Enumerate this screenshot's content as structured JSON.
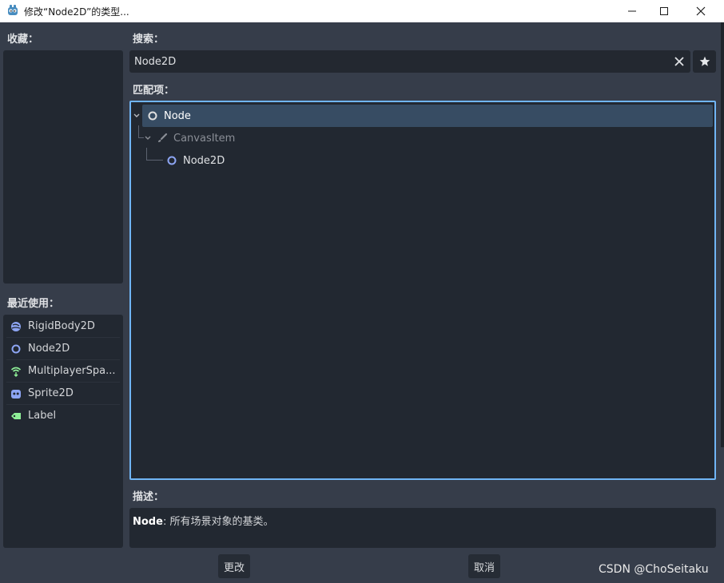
{
  "window": {
    "title": "修改“Node2D”的类型..."
  },
  "favorites": {
    "label": "收藏："
  },
  "recent": {
    "label": "最近使用：",
    "items": [
      {
        "label": "RigidBody2D",
        "icon": "rigidbody2d-icon",
        "color": "#8da5f3"
      },
      {
        "label": "Node2D",
        "icon": "node2d-icon",
        "color": "#8da5f3"
      },
      {
        "label": "MultiplayerSpa...",
        "icon": "multiplayer-spawner-icon",
        "color": "#8eef97"
      },
      {
        "label": "Sprite2D",
        "icon": "sprite2d-icon",
        "color": "#8da5f3"
      },
      {
        "label": "Label",
        "icon": "label-icon",
        "color": "#8eef97"
      }
    ]
  },
  "search": {
    "label": "搜索：",
    "value": "Node2D"
  },
  "matches": {
    "label": "匹配项：",
    "items": [
      {
        "label": "Node",
        "icon": "node-icon",
        "selected": true,
        "dimmed": false
      },
      {
        "label": "CanvasItem",
        "icon": "canvasitem-icon",
        "selected": false,
        "dimmed": true
      },
      {
        "label": "Node2D",
        "icon": "node2d-icon",
        "selected": false,
        "dimmed": false
      }
    ]
  },
  "description": {
    "label": "描述：",
    "class_name": "Node",
    "text": ": 所有场景对象的基类。"
  },
  "buttons": {
    "change": "更改",
    "cancel": "取消"
  },
  "watermark": "CSDN @ChoSeitaku",
  "colors": {
    "background": "#363d4a",
    "panel": "#222831",
    "accent": "#70b5f5",
    "selected_row": "#374c63",
    "node2d_blue": "#8da5f3",
    "control_green": "#8eef97"
  }
}
